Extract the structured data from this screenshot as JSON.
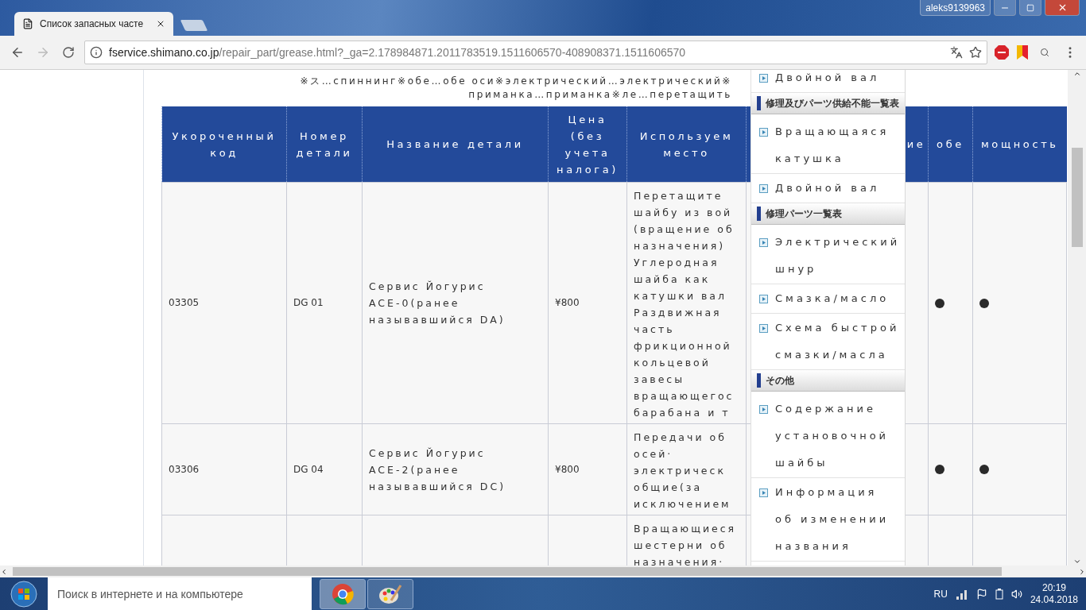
{
  "browser": {
    "tabs": [
      {
        "title": "Список запасных часте",
        "selected": true
      }
    ],
    "user": "aleks9139963",
    "address": {
      "host": "fservice.shimano.co.jp",
      "path": "/repair_part/grease.html?_ga=2.178984871.2011783519.1511606570-408908371.1511606570"
    }
  },
  "page": {
    "notice": [
      "※ス…спиннинг※обе…обе оси※электрический…электрический※",
      "приманка…приманка※ле…перетащить"
    ],
    "table": {
      "columns": [
        {
          "label": "Укороченный код"
        },
        {
          "label": "Номер детали"
        },
        {
          "label": "Название детали"
        },
        {
          "label": "Цена (без учета налога)"
        },
        {
          "label": "Используем место"
        },
        {
          "label": "ие"
        },
        {
          "label": "обе"
        },
        {
          "label": "мощность"
        }
      ],
      "rows": [
        {
          "code": "03305",
          "part_no": "DG 01",
          "name": [
            "Сервис Йогурис",
            "ACE-0(ранее",
            "называвшийся DA)"
          ],
          "price": "¥800",
          "place": [
            "Перетащите",
            "шайбу из вой",
            "(вращение об",
            "назначения)",
            "Углеродная",
            "шайба как",
            "катушки вал",
            "Раздвижная",
            "часть",
            "фрикционной",
            "кольцевой",
            "завесы",
            "вращающегос",
            "барабана и т"
          ],
          "dot_both": true,
          "dot_power": true
        },
        {
          "code": "03306",
          "part_no": "DG 04",
          "name": [
            "Сервис Йогурис",
            "ACE-2(ранее",
            "называвшийся DC)"
          ],
          "price": "¥800",
          "place": [
            "Передачи об",
            "осей·",
            "электрическ",
            "общие(за",
            "исключением"
          ],
          "dot_both": true,
          "dot_power": true
        },
        {
          "place": [
            "Вращающиеся",
            "шестерни об",
            "назначения·"
          ],
          "dot_both": false,
          "dot_power": false
        }
      ]
    },
    "side_menu": {
      "items": [
        {
          "kind": "link",
          "label": "Двойной вал"
        },
        {
          "kind": "heading",
          "label": "修理及びパーツ供給不能一覧表"
        },
        {
          "kind": "link",
          "label": "Вращающаяся катушка"
        },
        {
          "kind": "link",
          "label": "Двойной вал"
        },
        {
          "kind": "heading",
          "label": "修理パーツ一覧表"
        },
        {
          "kind": "link",
          "label": "Электрический шнур"
        },
        {
          "kind": "link",
          "label": "Смазка/масло"
        },
        {
          "kind": "link",
          "label": "Схема быстрой смазки/масла"
        },
        {
          "kind": "heading",
          "label": "その他"
        },
        {
          "kind": "link",
          "label": "Содержание установочной шайбы"
        },
        {
          "kind": "link",
          "label": "Информация об изменении названия"
        }
      ]
    }
  },
  "taskbar": {
    "search": {
      "placeholder": "Поиск в интернете и на компьютере"
    },
    "language": "RU",
    "time": "20:19",
    "date": "24.04.2018"
  }
}
